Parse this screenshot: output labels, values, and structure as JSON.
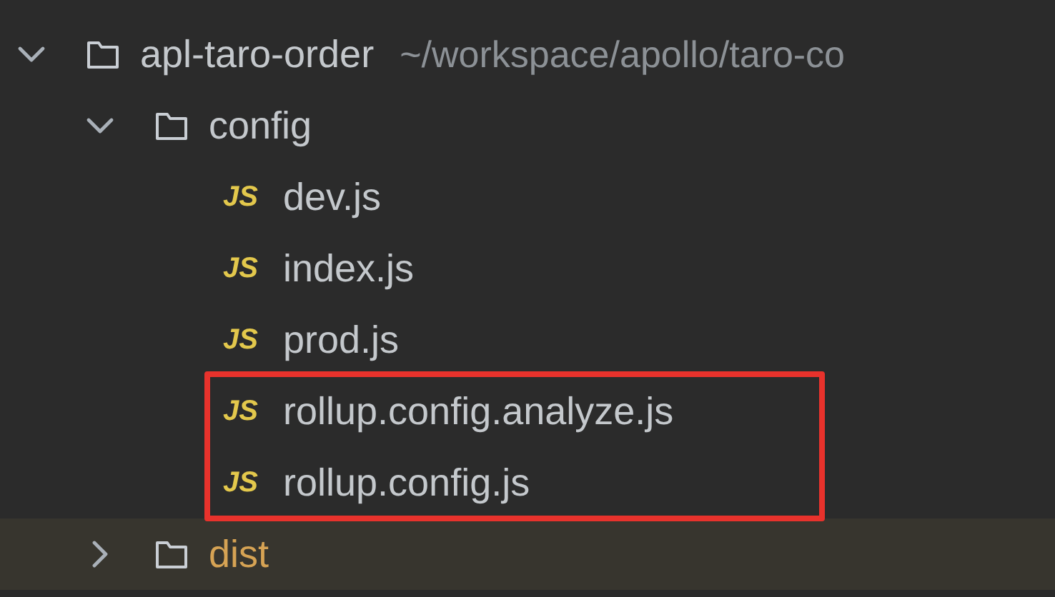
{
  "tree": [
    {
      "kind": "folder",
      "name": "apl-taro-order",
      "path": "~/workspace/apollo/taro-co",
      "expanded": true,
      "excluded": false,
      "children": [
        {
          "kind": "folder",
          "name": "config",
          "expanded": true,
          "excluded": false,
          "children": [
            {
              "kind": "file",
              "badge": "JS",
              "name": "dev.js",
              "highlighted": false
            },
            {
              "kind": "file",
              "badge": "JS",
              "name": "index.js",
              "highlighted": false
            },
            {
              "kind": "file",
              "badge": "JS",
              "name": "prod.js",
              "highlighted": false
            },
            {
              "kind": "file",
              "badge": "JS",
              "name": "rollup.config.analyze.js",
              "highlighted": true
            },
            {
              "kind": "file",
              "badge": "JS",
              "name": "rollup.config.js",
              "highlighted": true
            }
          ]
        },
        {
          "kind": "folder",
          "name": "dist",
          "expanded": false,
          "excluded": true
        }
      ]
    }
  ]
}
